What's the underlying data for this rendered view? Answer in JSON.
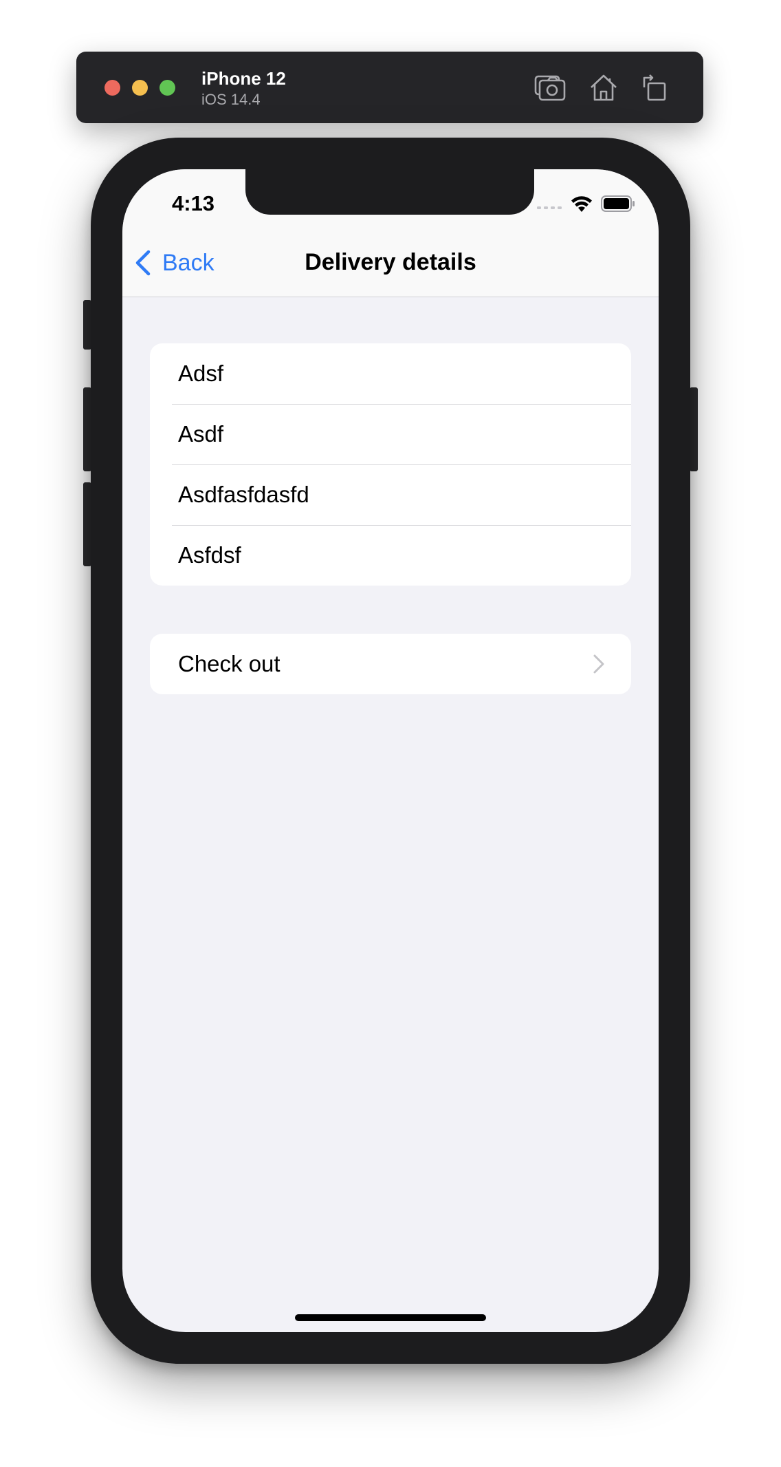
{
  "simulator": {
    "device_name": "iPhone 12",
    "os_version": "iOS 14.4",
    "toolbar_icons": [
      "screenshot-icon",
      "home-icon",
      "rotate-icon"
    ]
  },
  "status_bar": {
    "time": "4:13",
    "icons": [
      "cellular-signal-icon",
      "wifi-icon",
      "battery-icon"
    ]
  },
  "nav_bar": {
    "back_label": "Back",
    "title": "Delivery details"
  },
  "details_list": {
    "items": [
      {
        "label": "Adsf"
      },
      {
        "label": "Asdf"
      },
      {
        "label": "Asdfasfdasfd"
      },
      {
        "label": "Asfdsf"
      }
    ]
  },
  "checkout": {
    "label": "Check out",
    "icon": "chevron-right-icon"
  },
  "colors": {
    "accent": "#2f7bf5",
    "background": "#f2f2f7",
    "device_frame": "#1c1c1e"
  }
}
